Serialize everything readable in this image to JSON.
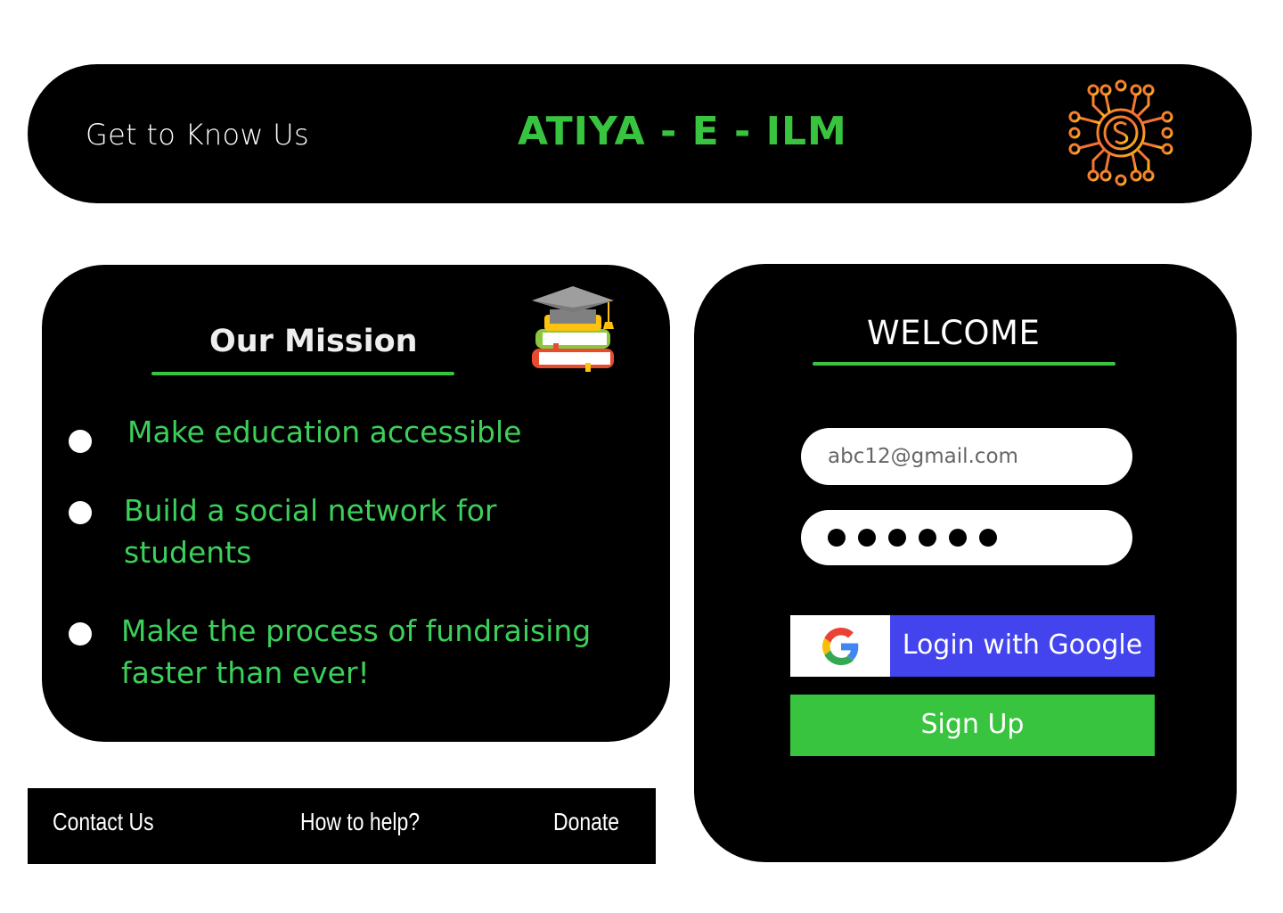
{
  "header": {
    "nav_link": "Get to Know Us",
    "brand": "ATIYA - E - ILM",
    "logo_icon": "coin-network-icon"
  },
  "mission": {
    "title": "Our Mission",
    "icon": "books-graduation-cap-icon",
    "items": [
      {
        "line1": "Make education accessible",
        "line2": ""
      },
      {
        "line1": "Build a social network for",
        "line2": "students"
      },
      {
        "line1": "Make the process of fundraising",
        "line2": "faster than ever!"
      }
    ]
  },
  "footer": {
    "contact": "Contact Us",
    "help": "How to help?",
    "donate": "Donate"
  },
  "login": {
    "title": "WELCOME",
    "email_value": "abc12@gmail.com",
    "password_mask_count": 6,
    "google_label": "Login with Google",
    "signup_label": "Sign Up"
  },
  "colors": {
    "accent_green": "#39c43f",
    "google_blue": "#4444ee",
    "panel": "#000000"
  }
}
